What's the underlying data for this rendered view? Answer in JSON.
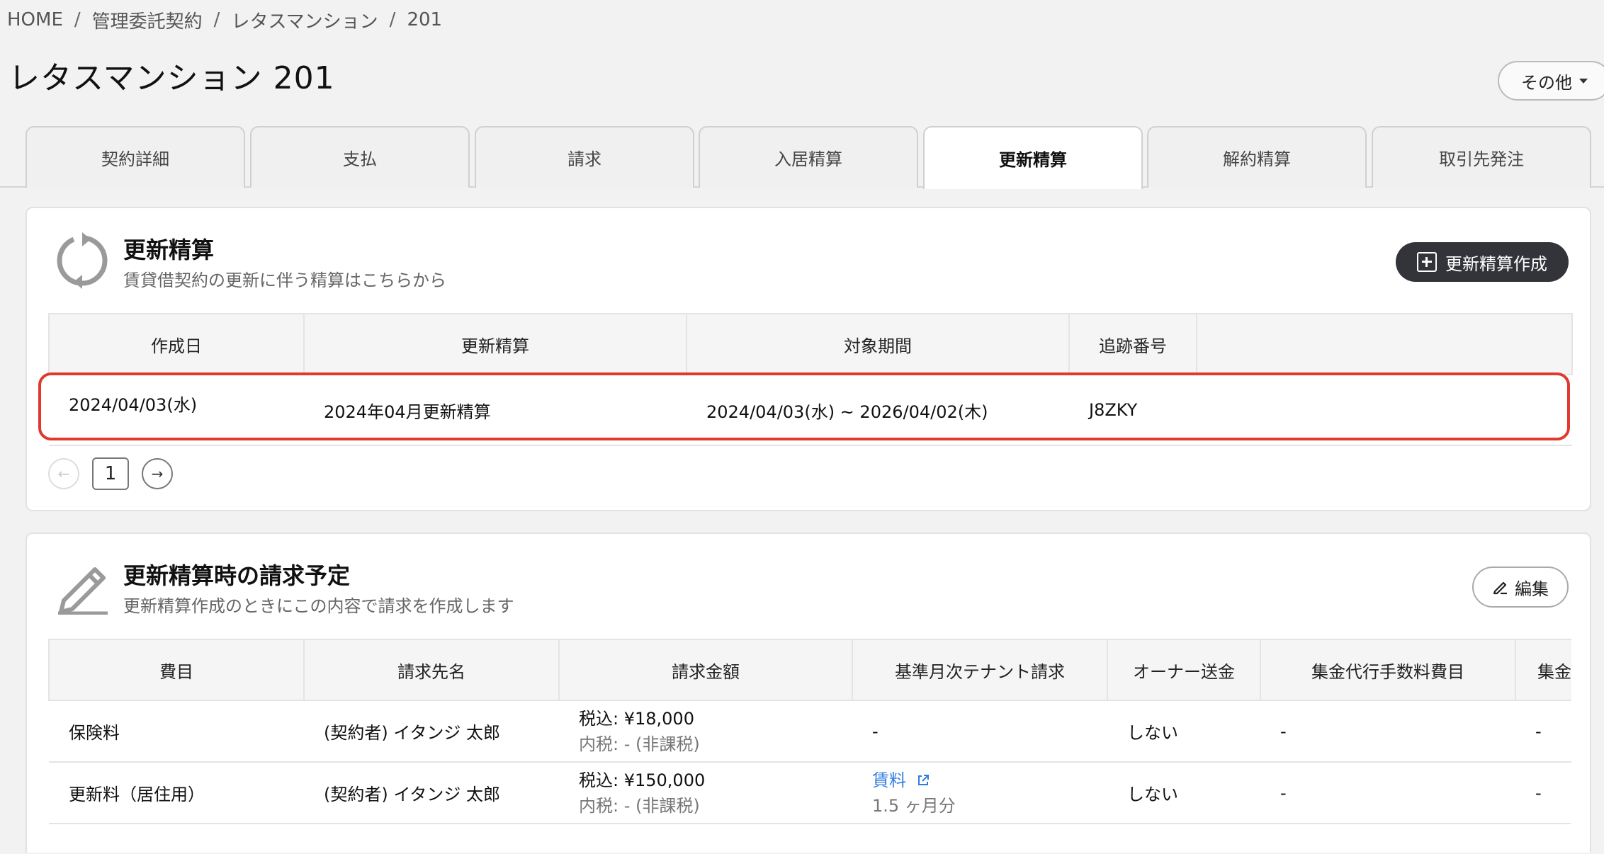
{
  "breadcrumb": {
    "items": [
      "HOME",
      "管理委託契約",
      "レタスマンション",
      "201"
    ],
    "separator": "/"
  },
  "page_title": "レタスマンション 201",
  "other_button": {
    "label": "その他"
  },
  "tabs": [
    {
      "label": "契約詳細"
    },
    {
      "label": "支払"
    },
    {
      "label": "請求"
    },
    {
      "label": "入居精算"
    },
    {
      "label": "更新精算",
      "active": true
    },
    {
      "label": "解約精算"
    },
    {
      "label": "取引先発注"
    }
  ],
  "renewal_section": {
    "title": "更新精算",
    "subtitle": "賃貸借契約の更新に伴う精算はこちらから",
    "create_button": "更新精算作成",
    "columns": [
      "作成日",
      "更新精算",
      "対象期間",
      "追跡番号",
      ""
    ],
    "rows": [
      {
        "created": "2024/04/03(水)",
        "name": "2024年04月更新精算",
        "period": "2024/04/03(水) ~ 2026/04/02(木)",
        "tracking": "J8ZKY",
        "extra": ""
      }
    ],
    "pagination": {
      "prev": "←",
      "current": "1",
      "next": "→"
    }
  },
  "billing_section": {
    "title": "更新精算時の請求予定",
    "subtitle": "更新精算作成のときにこの内容で請求を作成します",
    "edit_button": "編集",
    "columns": [
      "費目",
      "請求先名",
      "請求金額",
      "基準月次テナント請求",
      "オーナー送金",
      "集金代行手数料費目",
      "集金"
    ],
    "rows": [
      {
        "item": "保険料",
        "payee": "(契約者) イタンジ 太郎",
        "amount": "税込: ¥18,000",
        "tax": "内税: - (非課税)",
        "base": "-",
        "base_sub": "",
        "owner": "しない",
        "fee_item": "-",
        "last": "-"
      },
      {
        "item": "更新料（居住用）",
        "payee": "(契約者) イタンジ 太郎",
        "amount": "税込: ¥150,000",
        "tax": "内税: - (非課税)",
        "base": "賃料",
        "base_sub": "1.5 ヶ月分",
        "owner": "しない",
        "fee_item": "-",
        "last": "-"
      }
    ]
  },
  "colors": {
    "accent_link": "#2f7de1",
    "highlight_border": "#e03a2e",
    "dark_button": "#33343a"
  },
  "icons": [
    "refresh-icon",
    "pencil-icon",
    "plus-square-icon",
    "edit-icon",
    "external-link-icon",
    "arrow-left-icon",
    "arrow-right-icon",
    "caret-down-icon"
  ]
}
